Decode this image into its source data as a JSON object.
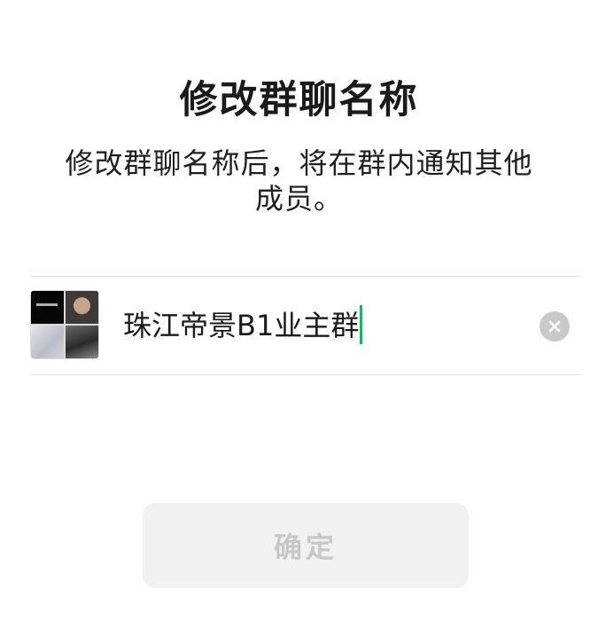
{
  "dialog": {
    "title": "修改群聊名称",
    "description": "修改群聊名称后，将在群内通知其他成员。"
  },
  "group": {
    "name": "珠江帝景B1业主群",
    "avatar_icon": "group-avatar-grid"
  },
  "clear_icon": "close-circle-icon",
  "confirm_label": "确定",
  "colors": {
    "caret": "#07c160",
    "button_bg": "#f1f1f1",
    "button_text_disabled": "#c7c7c7"
  }
}
